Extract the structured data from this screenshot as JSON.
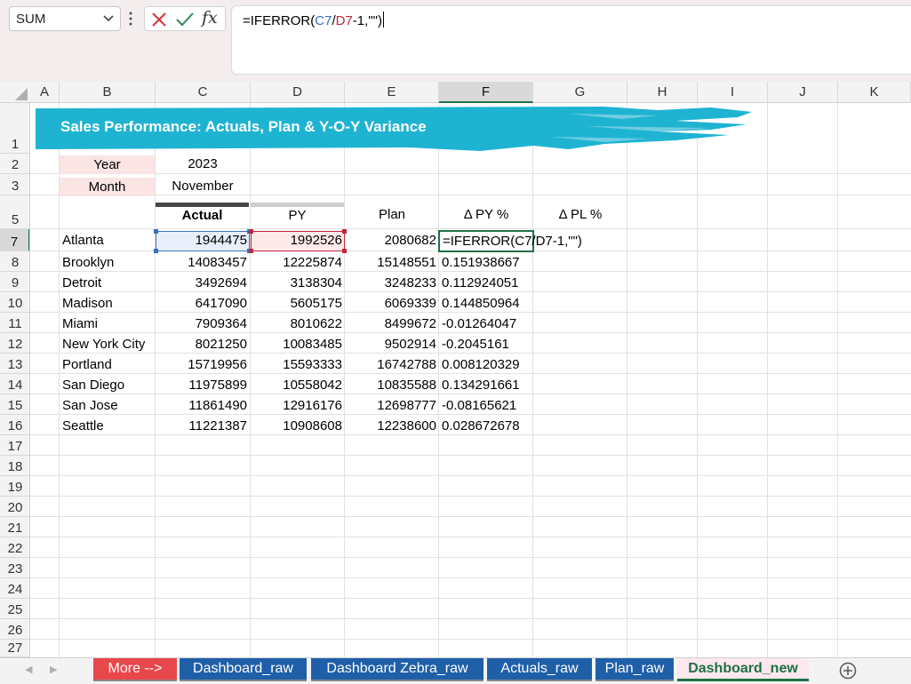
{
  "name_box": {
    "value": "SUM"
  },
  "formula_bar": {
    "prefix": "=IFERROR(",
    "ref1": "C7",
    "slash": "/",
    "ref2": "D7",
    "suffix": "-1,\"\")",
    "fx_label": "fx",
    "accent_ref1": "#2f6fd0",
    "accent_ref2": "#c0263a"
  },
  "columns": [
    "A",
    "B",
    "C",
    "D",
    "E",
    "F",
    "G",
    "H",
    "I",
    "J",
    "K"
  ],
  "rows": [
    "1",
    "2",
    "3",
    "5",
    "7",
    "8",
    "9",
    "10",
    "11",
    "12",
    "13",
    "14",
    "15",
    "16",
    "17",
    "18",
    "19",
    "20",
    "21",
    "22",
    "23",
    "24",
    "25",
    "26",
    "27"
  ],
  "banner": {
    "title": "Sales Performance: Actuals, Plan & Y-O-Y Variance",
    "color": "#1fb3d2"
  },
  "params": {
    "year_label": "Year",
    "year_value": "2023",
    "month_label": "Month",
    "month_value": "November"
  },
  "headers": {
    "actual": "Actual",
    "py": "PY",
    "plan": "Plan",
    "dpy": "Δ PY %",
    "dpl": "Δ PL %"
  },
  "editing_formula": "=IFERROR(C7/D7-1,\"\")",
  "table": [
    {
      "city": "Atlanta",
      "actual": "1944475",
      "py": "1992526",
      "plan": "2080682",
      "dpy": ""
    },
    {
      "city": "Brooklyn",
      "actual": "14083457",
      "py": "12225874",
      "plan": "15148551",
      "dpy": "0.151938667"
    },
    {
      "city": "Detroit",
      "actual": "3492694",
      "py": "3138304",
      "plan": "3248233",
      "dpy": "0.112924051"
    },
    {
      "city": "Madison",
      "actual": "6417090",
      "py": "5605175",
      "plan": "6069339",
      "dpy": "0.144850964"
    },
    {
      "city": "Miami",
      "actual": "7909364",
      "py": "8010622",
      "plan": "8499672",
      "dpy": "-0.01264047"
    },
    {
      "city": "New York City",
      "actual": "8021250",
      "py": "10083485",
      "plan": "9502914",
      "dpy": "-0.2045161"
    },
    {
      "city": "Portland",
      "actual": "15719956",
      "py": "15593333",
      "plan": "16742788",
      "dpy": "0.008120329"
    },
    {
      "city": "San Diego",
      "actual": "11975899",
      "py": "10558042",
      "plan": "10835588",
      "dpy": "0.134291661"
    },
    {
      "city": "San Jose",
      "actual": "11861490",
      "py": "12916176",
      "plan": "12698777",
      "dpy": "-0.08165621"
    },
    {
      "city": "Seattle",
      "actual": "11221387",
      "py": "10908608",
      "plan": "12238600",
      "dpy": "0.028672678"
    }
  ],
  "sheet_tabs": [
    {
      "label": "More -->",
      "style": "red"
    },
    {
      "label": "Dashboard_raw",
      "style": "blue"
    },
    {
      "label": "Dashboard Zebra_raw",
      "style": "blue"
    },
    {
      "label": "Actuals_raw",
      "style": "blue"
    },
    {
      "label": "Plan_raw",
      "style": "blue"
    },
    {
      "label": "Dashboard_new",
      "style": "active"
    }
  ],
  "selected": {
    "column": "F",
    "row": "7"
  }
}
